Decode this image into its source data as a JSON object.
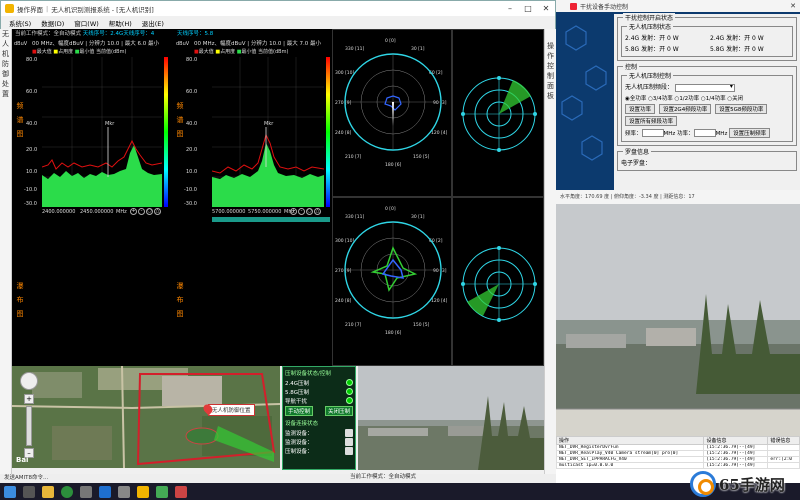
{
  "window": {
    "app_name": "操作界面",
    "title": "无人机识别测报系统 - [无人机识别]",
    "controls": [
      "–",
      "□",
      "✕"
    ]
  },
  "menu": [
    "系统(S)",
    "数据(D)",
    "窗口(W)",
    "帮助(H)",
    "退出(E)"
  ],
  "left_panel_label": [
    "无",
    "人",
    "机",
    "防",
    "御",
    "处",
    "置"
  ],
  "right_panel_label": [
    "操",
    "作",
    "控",
    "制",
    "面",
    "板"
  ],
  "spectrum": {
    "left": {
      "header_label": "当前工作模式：全自动模式",
      "header_band": "天线序号：2.4G天线序号：4",
      "params": "00 MHz、幅度dBuV | 分辨力 10.0 | 最大 6.0 最小",
      "legend": [
        "最大值",
        "占用度",
        "最小值",
        "当前值(dBm)"
      ],
      "vlabels": [
        "频",
        "谱",
        "图"
      ],
      "waterfall_labels": [
        "瀑",
        "布",
        "图"
      ],
      "ytick": [
        "dBuV",
        "80.0",
        "60.0",
        "40.0",
        "20.0",
        "10.0",
        "-10.0",
        "-30.0"
      ],
      "xtick": [
        "2400.000000",
        "2450.000000",
        "MHz"
      ],
      "zoom": [
        "+",
        "-",
        "○",
        "△"
      ]
    },
    "right": {
      "header_band": "天线序号：5.8",
      "params": "00 MHz、幅度dBuV | 分辨力 10.0 | 最大 7.0 最小",
      "legend": [
        "最大值",
        "占用度",
        "最小值",
        "当前值(dBm)"
      ],
      "vlabels": [
        "频",
        "谱",
        "图"
      ],
      "waterfall_labels": [
        "瀑",
        "布",
        "图"
      ],
      "ytick": [
        "dBuV",
        "80.0",
        "60.0",
        "40.0",
        "20.0",
        "10.0",
        "-10.0",
        "-30.0"
      ],
      "xtick": [
        "5700.000000",
        "5750.000000",
        "MHz"
      ],
      "zoom": [
        "+",
        "-",
        "○",
        "△"
      ]
    }
  },
  "polar": {
    "angle_labels": [
      "0 [0]",
      "30 [1]",
      "60 [2]",
      "90 [3]",
      "120 [4]",
      "150 [5]",
      "180 [6]",
      "210 [7]",
      "240 [8]",
      "270 [9]",
      "300 [10]",
      "330 [11]"
    ]
  },
  "control_panel": {
    "section1": "压制设备状态/控制",
    "rows": [
      {
        "label": "2.4G压制"
      },
      {
        "label": "5.8G压制"
      },
      {
        "label": "导航干扰"
      }
    ],
    "buttons": [
      "手动控制",
      "关闭压制"
    ],
    "section2": "设备连接状态",
    "conn_rows": [
      {
        "label": "监测设备："
      },
      {
        "label": "监测设备："
      },
      {
        "label": "压制设备："
      }
    ]
  },
  "map": {
    "popup_label": "无人机防御位置",
    "nav_icons": [
      "pan-control",
      "zoom-in",
      "zoom-out"
    ],
    "logo": "Bai"
  },
  "status_bar": {
    "left": "发送AMIT8命令...",
    "mode": "当前工作模式：全自动模式"
  },
  "right_panel": {
    "window_title": "干扰设备手动控制",
    "status_group": "干扰控制开启状态",
    "status_subgroup": "无人机压制状态",
    "status_cells": [
      "2.4G 发射：开 0 W",
      "2.4G 发射：开 0 W",
      "5.8G 发射：开 0 W",
      "5.8G 发射：开 0 W"
    ],
    "control_group": "控制",
    "control_subgroup": "无人机压制控制",
    "band_label": "无人机压制频段：",
    "radio_options": [
      "全功率",
      "3/4功率",
      "1/2功率",
      "1/4功率",
      "关闭"
    ],
    "buttons": [
      "设置功率",
      "设置2G4频段功率",
      "设置5G8频段功率",
      "设置所有频段功率"
    ],
    "freq_labels": [
      "频率：",
      "MHz",
      "功率：",
      "MHz"
    ],
    "set_jam_button": "设置压制频率",
    "compass_group": "罗盘信息",
    "compass_label": "电子罗盘："
  },
  "right_info": "水平角度：170.69 度 | 俯仰角度：-3.34 度 | 测距信息：17",
  "log": {
    "columns": [
      "操作",
      "设备信息",
      "错误信息"
    ],
    "rows": [
      [
        "NET_DVR_RegisterDvrFun",
        "[15:2:36.79]--[49]",
        ""
      ],
      [
        "NET_DVR_RealPlay_V40 Camera stream[0] pro[0]",
        "[15:2:36.79]--[49]",
        ""
      ],
      [
        "NET_DVR_SET_IPPARACFG_V40",
        "[15:2:36.79]--[49]",
        "err:[2:0"
      ],
      [
        "multicast ip=0.0.0.0",
        "[15:2:36.79]--[49]",
        ""
      ],
      [
        "",
        "[15:2:36.79]--[49]",
        ""
      ]
    ]
  },
  "watermark": "65手游网",
  "colors": {
    "spectrum_green": "#2bdc4a",
    "max_trace": "#e01010",
    "polar_cyan": "#2fd6e6",
    "polar_green": "#33cc33",
    "accent_blue": "#0c3a6e"
  }
}
